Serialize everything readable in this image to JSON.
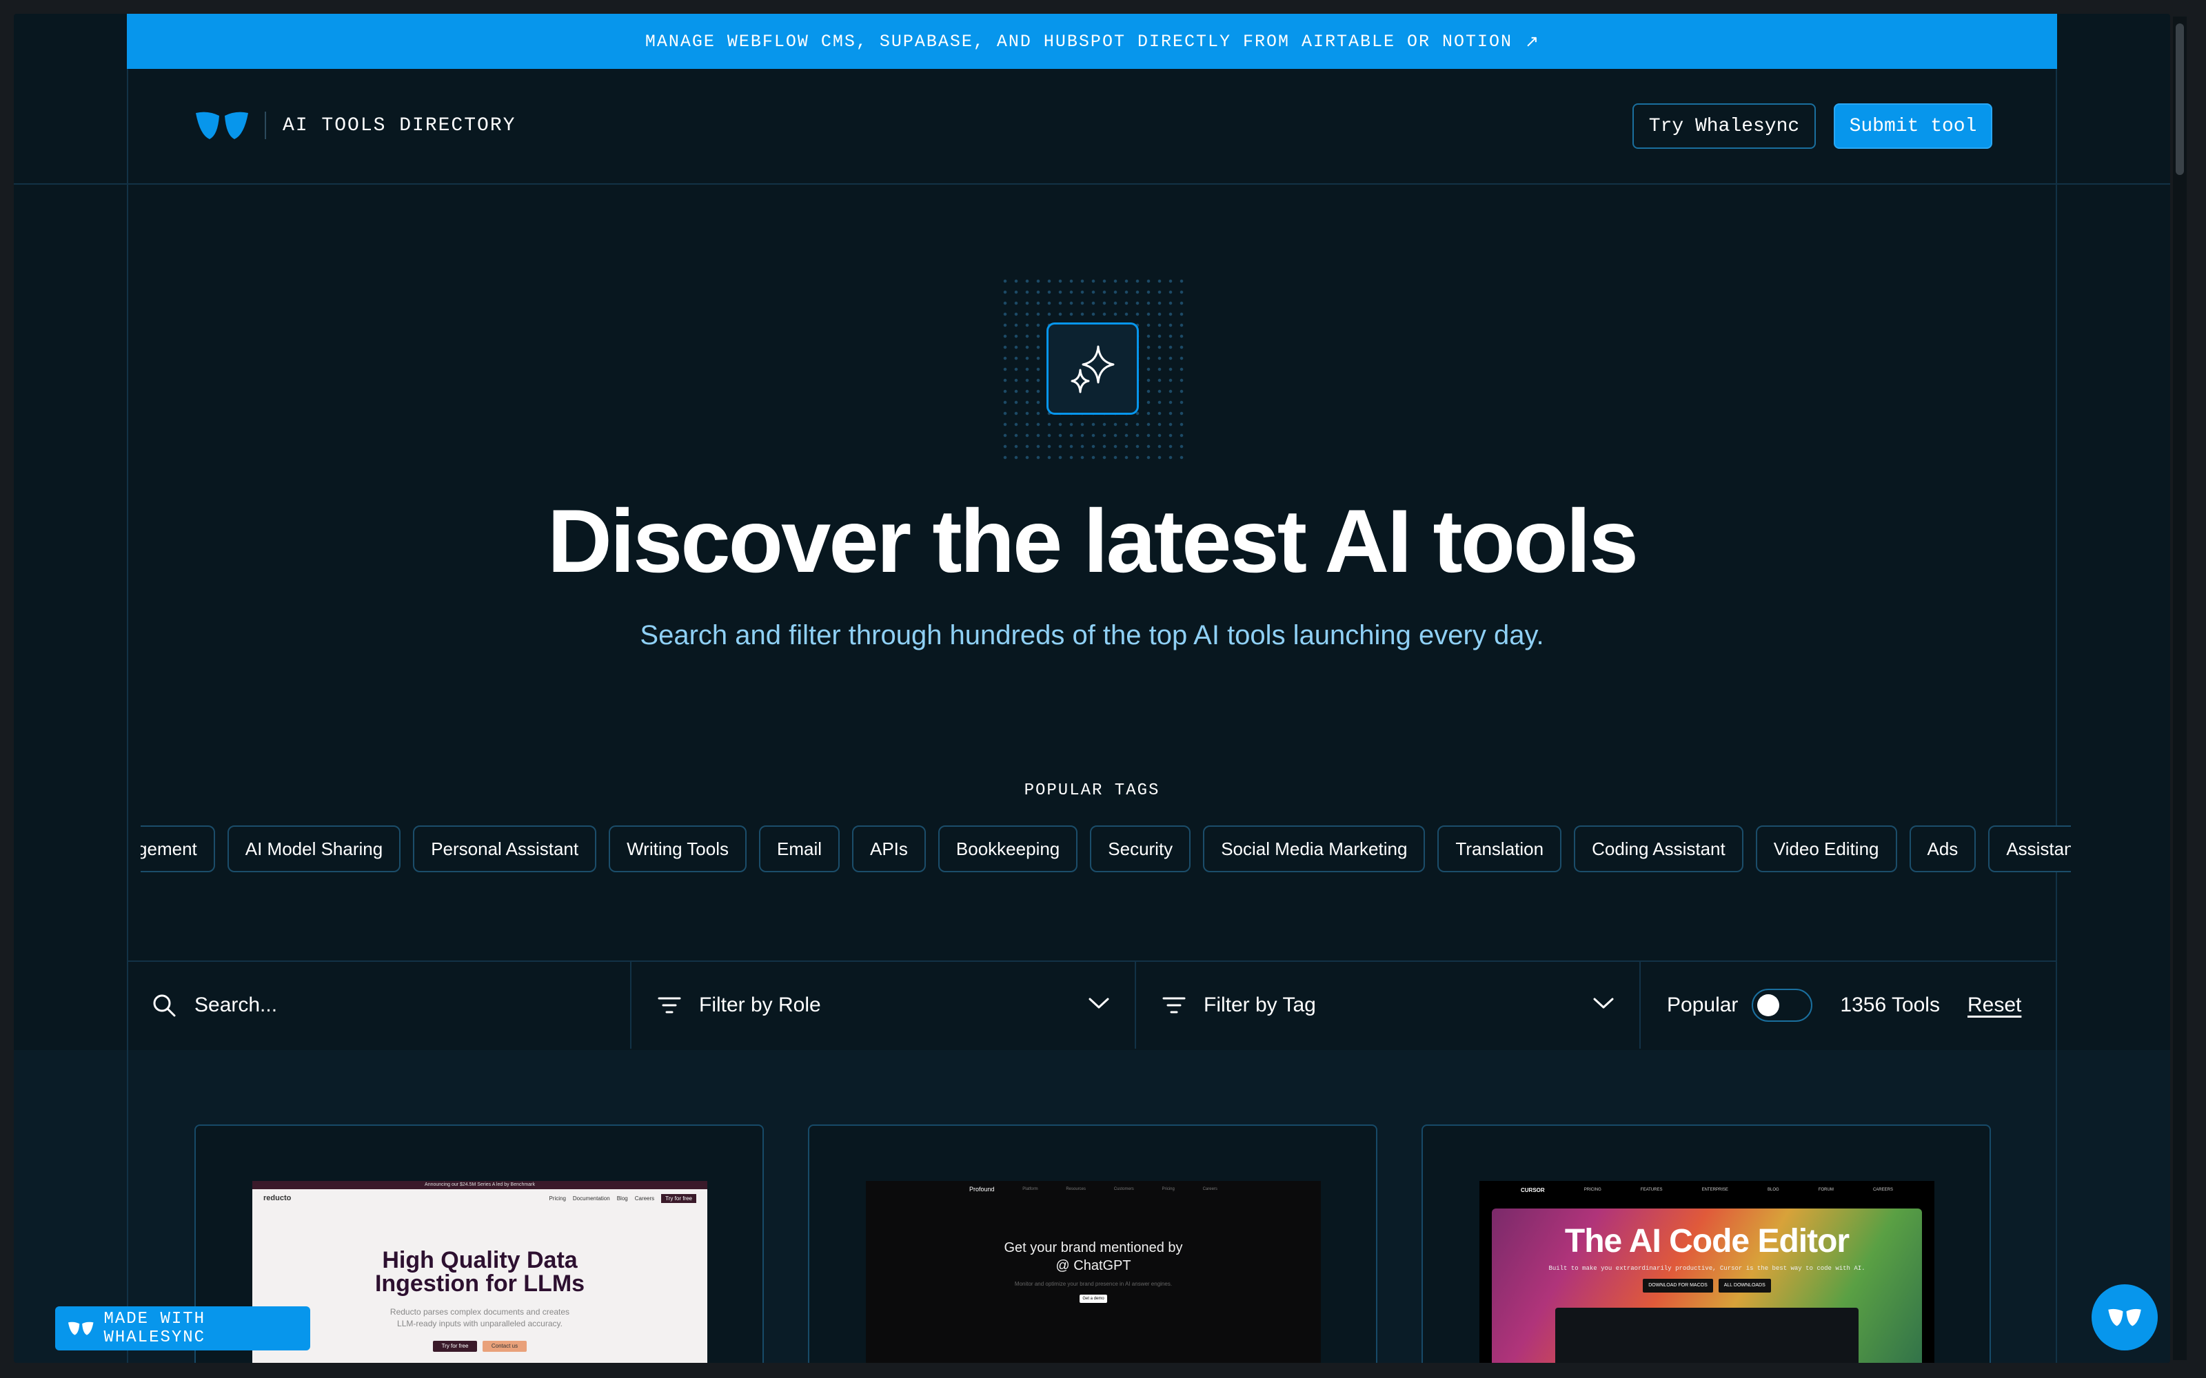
{
  "banner": {
    "text": "MANAGE WEBFLOW CMS, SUPABASE, AND HUBSPOT DIRECTLY FROM AIRTABLE OR NOTION",
    "arrow": "↗"
  },
  "header": {
    "logo_text": "AI TOOLS DIRECTORY",
    "try_button": "Try Whalesync",
    "submit_button": "Submit tool"
  },
  "hero": {
    "icon": "sparkles-icon",
    "title": "Discover the latest AI tools",
    "subtitle": "Search and filter through hundreds of the top AI tools launching every day."
  },
  "tags": {
    "label": "POPULAR TAGS",
    "items": [
      "Management",
      "AI Model Sharing",
      "Personal Assistant",
      "Writing Tools",
      "Email",
      "APIs",
      "Bookkeeping",
      "Security",
      "Social Media Marketing",
      "Translation",
      "Coding Assistant",
      "Video Editing",
      "Ads",
      "Assistant"
    ]
  },
  "filters": {
    "search_placeholder": "Search...",
    "role_label": "Filter by Role",
    "tag_label": "Filter by Tag",
    "popular_label": "Popular",
    "popular_enabled": false,
    "tool_count": "1356 Tools",
    "reset_label": "Reset"
  },
  "cards": [
    {
      "brand": "reducto",
      "strip": "Announcing our $24.5M Series A led by Benchmark",
      "nav": [
        "Pricing",
        "Documentation",
        "Blog",
        "Careers",
        "Try for free"
      ],
      "headline_1": "High Quality Data",
      "headline_2": "Ingestion for LLMs",
      "body_1": "Reducto parses complex documents and creates",
      "body_2": "LLM-ready inputs with unparalleled accuracy.",
      "cta_1": "Try for free",
      "cta_2": "Contact us"
    },
    {
      "brand": "Profound",
      "nav": [
        "Platform",
        "Resources",
        "Customers",
        "Pricing",
        "Careers"
      ],
      "headline_1": "Get your brand mentioned by",
      "headline_2": "@ ChatGPT",
      "body": "Monitor and optimize your brand presence in AI answer engines.",
      "cta": "Get a demo"
    },
    {
      "brand": "CURSOR",
      "nav": [
        "PRICING",
        "FEATURES",
        "ENTERPRISE",
        "BLOG",
        "FORUM",
        "CAREERS"
      ],
      "headline": "The AI Code Editor",
      "body": "Built to make you extraordinarily productive, Cursor is the best way to code with AI.",
      "cta_1": "DOWNLOAD FOR MACOS",
      "cta_2": "ALL DOWNLOADS"
    }
  ],
  "widgets": {
    "made_with": "MADE WITH WHALESYNC"
  },
  "colors": {
    "accent": "#0796ec",
    "background": "#08171f",
    "border": "#174a68",
    "subtitle": "#8fd0f5"
  }
}
